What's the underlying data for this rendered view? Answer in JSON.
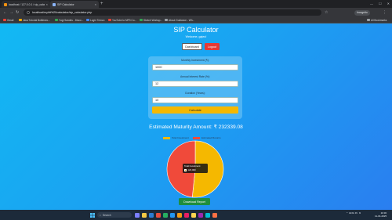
{
  "browser": {
    "tabs": [
      {
        "label": "localhost / 127.0.0.1 / sip_calcu..."
      },
      {
        "label": "SIP Calculator"
      }
    ],
    "new_tab": "+",
    "window_controls": [
      "—",
      "☐",
      "✕"
    ],
    "url": "localhost/myhtt%20calculator/sip_calculator.php",
    "profile": "Incognito",
    "menu": "⋮",
    "bookmarks": [
      {
        "label": "Gmail",
        "color": "#ea4335"
      },
      {
        "label": "Java Tutorial Bottlenec...",
        "color": "#f9ab00"
      },
      {
        "label": "Yugi Sandes - Disco...",
        "color": "#34a853"
      },
      {
        "label": "Login Trenzo",
        "color": "#4285f4"
      },
      {
        "label": "YouTube to MP3 Co...",
        "color": "#ea4335"
      },
      {
        "label": "Sketch Worksp...",
        "color": "#34a853"
      },
      {
        "label": "About Guidance - Wh...",
        "color": "#9aa0a6"
      }
    ],
    "all_bookmarks": "All Bookmarks"
  },
  "app": {
    "title": "SIP Calculator",
    "welcome": "Welcome, gajeu!",
    "dashboard_button": "Dashboard",
    "logout_button": "Logout",
    "monthly_label": "Monthly Investment (₹):",
    "monthly_value": "1000",
    "rate_label": "Annual Interest Rate (%):",
    "rate_value": "12",
    "duration_label": "Duration (Years):",
    "duration_value": "10",
    "calculate_button": "Calculate",
    "result_text": "Estimated Maturity Amount: ₹ 232339.08",
    "download_button": "Download Report",
    "colors": {
      "accent_yellow": "#f5b800",
      "accent_red": "#f04a3a",
      "logout_red": "#e53935",
      "download_green": "#1e8e3e"
    }
  },
  "chart_data": {
    "type": "pie",
    "series": [
      {
        "name": "Total Investment",
        "value": 120000,
        "color": "#f5b800"
      },
      {
        "name": "Estimated Returns",
        "value": 112339.08,
        "color": "#f04a3a"
      }
    ],
    "tooltip": {
      "title": "Total Investment",
      "value": "120,000"
    },
    "legend_position": "top"
  },
  "taskbar": {
    "search_placeholder": "Search",
    "tray_lang": "ENG IN",
    "time": "10:30",
    "date": "11-04-2025"
  }
}
